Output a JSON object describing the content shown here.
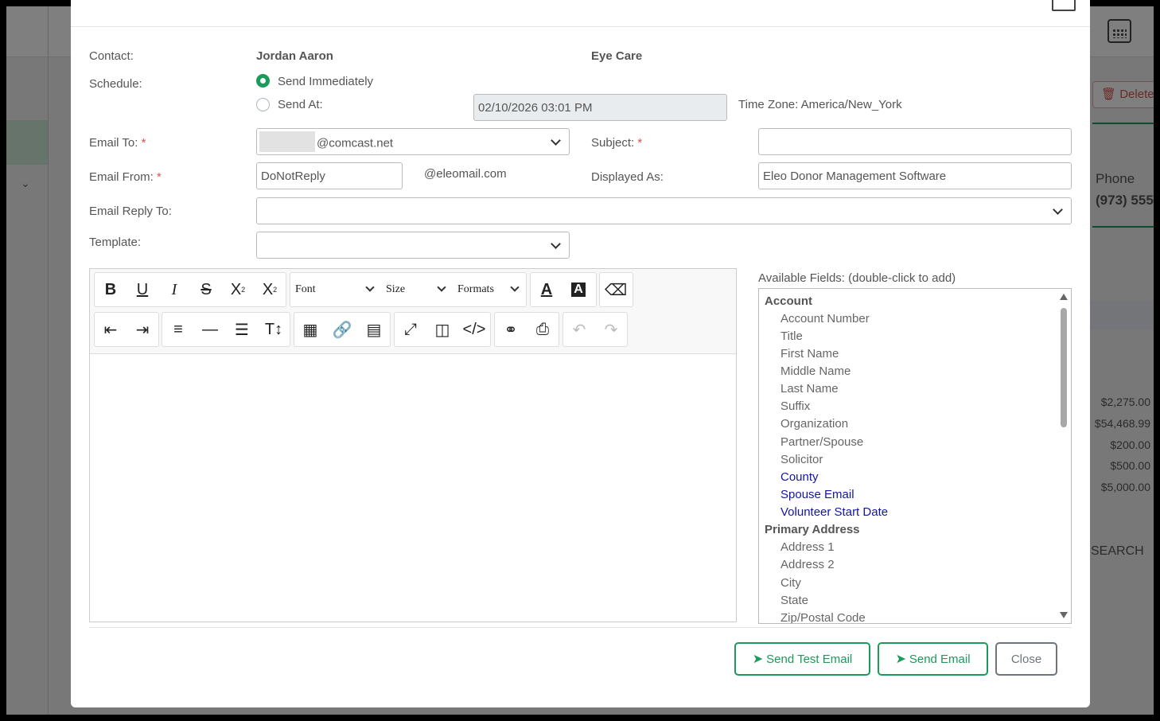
{
  "background": {
    "delete_label": "Delete",
    "phone_label": "Phone",
    "phone_value": "(973) 555",
    "amounts": [
      "$2,275.00",
      "$54,468.99",
      "$200.00",
      "$500.00",
      "$5,000.00"
    ],
    "search_label": "SEARCH"
  },
  "modal": {
    "contact_label": "Contact:",
    "contact_name": "Jordan Aaron",
    "contact_org": "Eye Care",
    "schedule_label": "Schedule:",
    "send_immediately": "Send Immediately",
    "send_at": "Send At:",
    "send_at_value": "02/10/2026 03:01  PM",
    "timezone": "Time Zone: America/New_York",
    "email_to_label": "Email To:",
    "email_to_value": "@comcast.net",
    "subject_label": "Subject:",
    "subject_value": "",
    "email_from_label": "Email From:",
    "email_from_value": "DoNotReply",
    "email_domain": "@eleomail.com",
    "displayed_as_label": "Displayed As:",
    "displayed_as_value": "Eleo Donor Management Software",
    "reply_to_label": "Email Reply To:",
    "template_label": "Template:",
    "required_mark": "*"
  },
  "toolbar": {
    "font_label": "Font",
    "size_label": "Size",
    "formats_label": "Formats"
  },
  "fields": {
    "heading": "Available Fields: (double-click to add)",
    "account_group": "Account",
    "account_items": [
      "Account Number",
      "Title",
      "First Name",
      "Middle Name",
      "Last Name",
      "Suffix",
      "Organization",
      "Partner/Spouse",
      "Solicitor"
    ],
    "custom_items": [
      "County",
      "Spouse Email",
      "Volunteer Start Date"
    ],
    "address_group": "Primary Address",
    "address_items": [
      "Address 1",
      "Address 2",
      "City",
      "State",
      "Zip/Postal Code"
    ]
  },
  "buttons": {
    "send_test": "Send Test Email",
    "send": "Send Email",
    "close": "Close"
  },
  "colors": {
    "accent": "#1a9a5b",
    "required": "#d9534f",
    "custom_field": "#1414a8"
  }
}
